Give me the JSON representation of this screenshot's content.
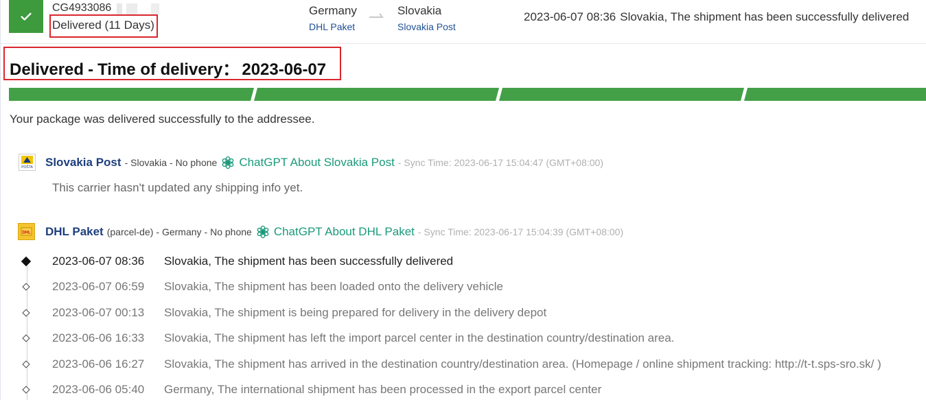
{
  "header": {
    "tracking_number": "CG4933086",
    "status_label": "Delivered (11 Days)",
    "origin_country": "Germany",
    "origin_carrier": "DHL Paket",
    "destination_country": "Slovakia",
    "destination_carrier": "Slovakia Post",
    "latest_time": "2023-06-07 08:36",
    "latest_event": "Slovakia, The shipment has been successfully delivered"
  },
  "headline": {
    "status": "Delivered",
    "dash": "-",
    "label": "Time of delivery：",
    "date": "2023-06-07"
  },
  "progress": {
    "segments": 4,
    "completed": 4,
    "color": "#43a047"
  },
  "summary": "Your package was delivered successfully to the addressee.",
  "carriers": [
    {
      "name": "Slovakia Post",
      "sub": "",
      "country": "- Slovakia",
      "phone": "- No phone",
      "chatgpt_link": "ChatGPT About Slovakia Post",
      "sync": "- Sync Time: 2023-06-17 15:04:47 (GMT+08:00)",
      "no_info": "This carrier hasn't updated any shipping info yet.",
      "logo_text": "POŠTA"
    },
    {
      "name": "DHL Paket",
      "sub": "(parcel-de)",
      "country": "- Germany",
      "phone": "- No phone",
      "chatgpt_link": "ChatGPT About DHL Paket",
      "sync": "- Sync Time: 2023-06-17 15:04:39 (GMT+08:00)",
      "logo_text": "DHL"
    }
  ],
  "events": [
    {
      "time": "2023-06-07 08:36",
      "desc": "Slovakia, The shipment has been successfully delivered"
    },
    {
      "time": "2023-06-07 06:59",
      "desc": "Slovakia, The shipment has been loaded onto the delivery vehicle"
    },
    {
      "time": "2023-06-07 00:13",
      "desc": "Slovakia, The shipment is being prepared for delivery in the delivery depot"
    },
    {
      "time": "2023-06-06 16:33",
      "desc": "Slovakia, The shipment has left the import parcel center in the destination country/destination area."
    },
    {
      "time": "2023-06-06 16:27",
      "desc": "Slovakia, The shipment has arrived in the destination country/destination area. (Homepage / online shipment tracking: http://t-t.sps-sro.sk/ )"
    },
    {
      "time": "2023-06-06 05:40",
      "desc": "Germany, The international shipment has been processed in the export parcel center"
    }
  ],
  "icons": {
    "status": "check-icon",
    "route": "arrow-right-icon",
    "chatgpt": "openai-icon"
  }
}
